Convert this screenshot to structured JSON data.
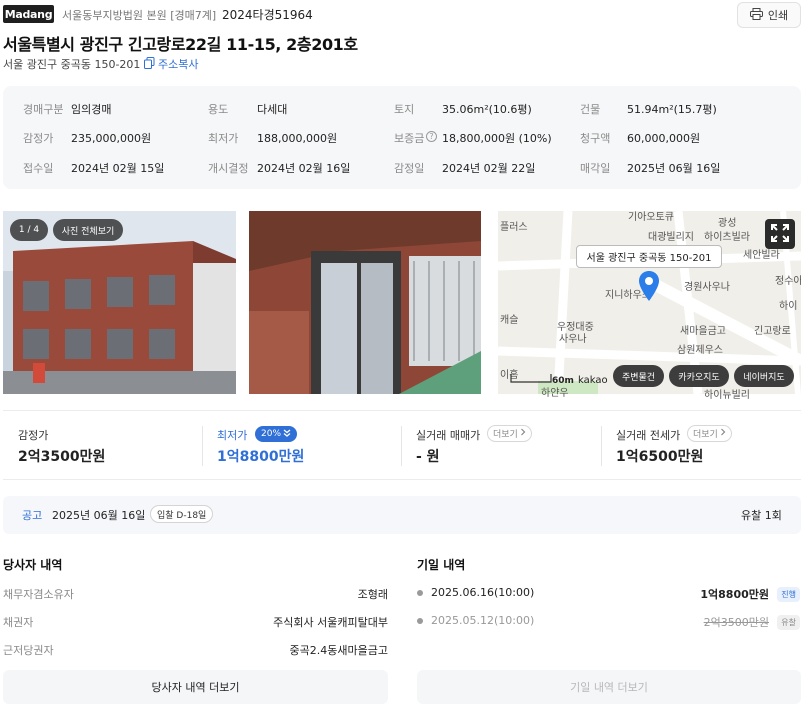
{
  "header": {
    "logo": "Madang",
    "court": "서울동부지방법원 본원 [경매7계]",
    "case_no": "2024타경51964",
    "print_label": "인쇄",
    "title": "서울특별시 광진구 긴고랑로22길 11-15, 2층201호",
    "lot_address": "서울 광진구 중곡동 150-201",
    "copy_label": "주소복사"
  },
  "info": {
    "rows": [
      [
        {
          "label": "경매구분",
          "value": "임의경매"
        },
        {
          "label": "용도",
          "value": "다세대"
        },
        {
          "label": "토지",
          "value": "35.06m²(10.6평)"
        },
        {
          "label": "건물",
          "value": "51.94m²(15.7평)"
        }
      ],
      [
        {
          "label": "감정가",
          "value": "235,000,000원"
        },
        {
          "label": "최저가",
          "value": "188,000,000원"
        },
        {
          "label": "보증금",
          "value": "18,800,000원 (10%)"
        },
        {
          "label": "청구액",
          "value": "60,000,000원"
        }
      ],
      [
        {
          "label": "접수일",
          "value": "2024년 02월 15일"
        },
        {
          "label": "개시결정",
          "value": "2024년 02월 16일"
        },
        {
          "label": "감정일",
          "value": "2024년 02월 22일"
        },
        {
          "label": "매각일",
          "value": "2025년 06월 16일"
        }
      ]
    ]
  },
  "gallery": {
    "counter": "1 / 4",
    "view_all": "사진 전체보기"
  },
  "map": {
    "address_bubble": "서울 광진구 중곡동 150-201",
    "scale": "60m",
    "brand": "kakao",
    "buttons": [
      "주변물건",
      "카카오지도",
      "네이버지도"
    ],
    "labels": [
      "플러스",
      "기아오토큐",
      "광성",
      "대광빌리지",
      "하이츠빌라",
      "세안빌라",
      "정수아",
      "지니하우스",
      "경원사우나",
      "하이",
      "캐슬",
      "우정대중",
      "사우나",
      "새마을금고",
      "긴고랑로",
      "삼원제우스",
      "이홈",
      "하얀우",
      "하이뉴빌리"
    ]
  },
  "prices": [
    {
      "label": "감정가",
      "value": "2억3500만원"
    },
    {
      "label": "최저가",
      "value": "1억8800만원",
      "badge": "20%"
    },
    {
      "label": "실거래 매매가",
      "value": "- 원",
      "more": "더보기"
    },
    {
      "label": "실거래 전세가",
      "value": "1억6500만원",
      "more": "더보기"
    }
  ],
  "notice": {
    "label": "공고",
    "date": "2025년 06월 16일",
    "dday": "입찰 D-18일",
    "result": "유찰 1회"
  },
  "parties": {
    "title": "당사자 내역",
    "rows": [
      {
        "label": "채무자겸소유자",
        "value": "조형래"
      },
      {
        "label": "채권자",
        "value": "주식회사 서울캐피탈대부"
      },
      {
        "label": "근저당권자",
        "value": "중곡2.4동새마을금고"
      }
    ],
    "more_label": "당사자 내역 더보기"
  },
  "history": {
    "title": "기일 내역",
    "rows": [
      {
        "date": "2025.06.16(10:00)",
        "price": "1억8800만원",
        "status": "진행"
      },
      {
        "date": "2025.05.12(10:00)",
        "price": "2억3500만원",
        "status": "유찰"
      }
    ],
    "more_label": "기일 내역 더보기"
  },
  "colors": {
    "accent": "#2f6fd6",
    "pin": "#2b7de9",
    "progress_badge_bg": "#e8f0fd"
  }
}
